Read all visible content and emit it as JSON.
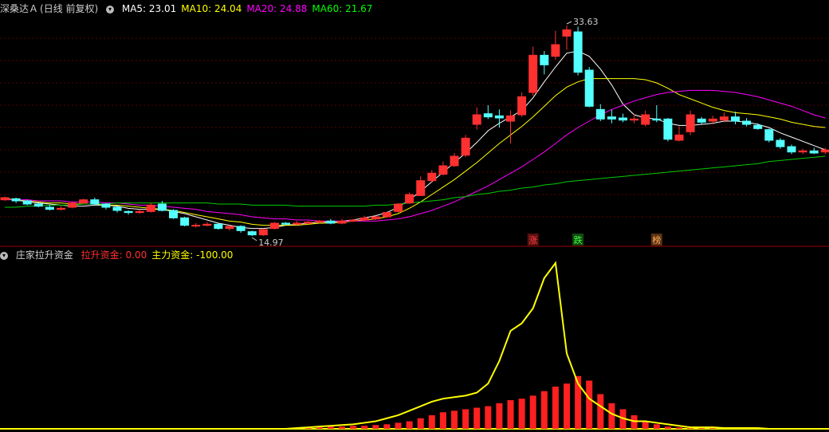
{
  "main_panel": {
    "stock_name": "深桑达Ａ",
    "period": "(日线 前复权)",
    "ma": [
      {
        "label": "MA5:",
        "value": "23.01",
        "color": "#ffffff"
      },
      {
        "label": "MA10:",
        "value": "24.04",
        "color": "#ffff00"
      },
      {
        "label": "MA20:",
        "value": "24.88",
        "color": "#ff00ff"
      },
      {
        "label": "MA60:",
        "value": "21.67",
        "color": "#00ff00"
      }
    ],
    "high_label": "33.63",
    "low_label": "14.97",
    "badges": [
      {
        "text": "涨",
        "color": "#ff4040",
        "bg": "#5a1010"
      },
      {
        "text": "跌",
        "color": "#40ff40",
        "bg": "#104a10"
      },
      {
        "text": "榜",
        "color": "#ffb060",
        "bg": "#5a3010"
      }
    ]
  },
  "sub_panel": {
    "indicator_name": "庄家拉升资金",
    "items": [
      {
        "label": "拉升资金:",
        "value": "0.00",
        "color": "#ff3030"
      },
      {
        "label": "主力资金:",
        "value": "-100.00",
        "color": "#ffff00"
      }
    ]
  },
  "chart_data": {
    "type": "candlestick",
    "price_range": [
      13.5,
      34.5
    ],
    "candles": [
      [
        17.2,
        17.4,
        17.5,
        17.1
      ],
      [
        17.3,
        17.1,
        17.4,
        16.9
      ],
      [
        17.1,
        16.8,
        17.2,
        16.7
      ],
      [
        16.8,
        16.6,
        16.9,
        16.5
      ],
      [
        16.5,
        16.3,
        16.7,
        16.2
      ],
      [
        16.3,
        16.4,
        16.6,
        16.2
      ],
      [
        16.5,
        16.9,
        17.0,
        16.4
      ],
      [
        16.9,
        17.2,
        17.3,
        16.8
      ],
      [
        17.2,
        16.8,
        17.4,
        16.7
      ],
      [
        16.8,
        16.5,
        16.9,
        16.3
      ],
      [
        16.5,
        16.2,
        16.6,
        16.0
      ],
      [
        16.1,
        16.0,
        16.2,
        15.8
      ],
      [
        16.0,
        16.1,
        16.3,
        15.9
      ],
      [
        16.1,
        16.7,
        16.9,
        16.0
      ],
      [
        16.8,
        16.2,
        17.1,
        16.1
      ],
      [
        16.2,
        15.5,
        16.3,
        15.4
      ],
      [
        15.5,
        14.8,
        15.6,
        14.7
      ],
      [
        14.8,
        14.8,
        15.0,
        14.6
      ],
      [
        14.8,
        14.9,
        15.1,
        14.7
      ],
      [
        14.9,
        14.5,
        15.0,
        14.4
      ],
      [
        14.5,
        14.7,
        14.8,
        14.3
      ],
      [
        14.7,
        14.3,
        14.8,
        14.1
      ],
      [
        14.2,
        13.9,
        14.3,
        13.8
      ],
      [
        13.9,
        14.4,
        14.5,
        13.8
      ],
      [
        14.5,
        15.0,
        15.1,
        14.4
      ],
      [
        15.0,
        14.9,
        15.1,
        14.8
      ],
      [
        14.9,
        15.0,
        15.2,
        14.8
      ],
      [
        15.0,
        15.1,
        15.2,
        14.9
      ],
      [
        15.1,
        15.2,
        15.3,
        15.0
      ],
      [
        15.2,
        15.0,
        15.4,
        14.9
      ],
      [
        15.0,
        15.2,
        15.4,
        14.9
      ],
      [
        15.2,
        15.3,
        15.4,
        15.1
      ],
      [
        15.3,
        15.5,
        15.7,
        15.2
      ],
      [
        15.4,
        15.6,
        15.7,
        15.3
      ],
      [
        15.6,
        16.0,
        16.1,
        15.5
      ],
      [
        16.1,
        16.8,
        16.9,
        16.0
      ],
      [
        16.9,
        17.7,
        17.9,
        16.8
      ],
      [
        17.6,
        19.0,
        19.4,
        17.6
      ],
      [
        19.0,
        19.7,
        20.0,
        18.8
      ],
      [
        19.6,
        20.4,
        20.8,
        19.5
      ],
      [
        20.4,
        21.3,
        21.6,
        20.3
      ],
      [
        21.4,
        23.0,
        23.3,
        21.2
      ],
      [
        24.3,
        25.2,
        25.9,
        23.8
      ],
      [
        25.3,
        25.0,
        26.1,
        24.8
      ],
      [
        25.1,
        24.9,
        25.7,
        24.0
      ],
      [
        24.6,
        25.1,
        25.6,
        22.5
      ],
      [
        25.2,
        26.9,
        27.3,
        25.0
      ],
      [
        27.3,
        30.8,
        31.6,
        27.0
      ],
      [
        30.8,
        29.9,
        31.2,
        29.0
      ],
      [
        30.7,
        31.8,
        33.1,
        30.4
      ],
      [
        32.6,
        33.2,
        33.6,
        31.3
      ],
      [
        33.0,
        29.2,
        33.5,
        28.9
      ],
      [
        29.4,
        26.0,
        29.7,
        25.9
      ],
      [
        25.7,
        24.8,
        26.2,
        24.6
      ],
      [
        25.0,
        24.8,
        25.7,
        24.4
      ],
      [
        24.9,
        24.7,
        25.3,
        24.5
      ],
      [
        24.7,
        24.8,
        25.3,
        24.4
      ],
      [
        24.3,
        25.2,
        25.6,
        24.1
      ],
      [
        24.8,
        24.7,
        26.1,
        24.5
      ],
      [
        24.8,
        22.9,
        24.9,
        22.7
      ],
      [
        22.8,
        23.3,
        24.1,
        22.7
      ],
      [
        23.6,
        25.2,
        25.6,
        23.3
      ],
      [
        24.8,
        24.5,
        25.0,
        24.3
      ],
      [
        24.6,
        24.8,
        25.1,
        24.3
      ],
      [
        24.7,
        25.0,
        25.4,
        24.5
      ],
      [
        25.0,
        24.6,
        25.5,
        24.3
      ],
      [
        24.6,
        24.3,
        24.9,
        24.1
      ],
      [
        24.2,
        23.9,
        24.4,
        23.8
      ],
      [
        23.8,
        22.8,
        23.9,
        22.6
      ],
      [
        22.8,
        22.2,
        23.0,
        22.0
      ],
      [
        22.2,
        21.7,
        22.4,
        21.5
      ],
      [
        21.7,
        21.8,
        22.0,
        21.5
      ],
      [
        21.8,
        21.6,
        22.1,
        21.5
      ],
      [
        21.7,
        21.9,
        22.1,
        21.5
      ]
    ],
    "series": [
      {
        "name": "MA5",
        "color": "#ffffff",
        "values": [
          17.3,
          17.2,
          17.0,
          16.9,
          16.8,
          16.7,
          16.6,
          16.6,
          16.7,
          16.7,
          16.6,
          16.4,
          16.3,
          16.3,
          16.3,
          16.1,
          15.9,
          15.6,
          15.3,
          15.0,
          14.8,
          14.6,
          14.5,
          14.5,
          14.6,
          14.8,
          14.9,
          15.0,
          15.1,
          15.1,
          15.2,
          15.3,
          15.5,
          15.7,
          16.0,
          16.5,
          17.2,
          18.0,
          18.9,
          19.8,
          20.7,
          21.6,
          22.6,
          23.7,
          24.4,
          25.0,
          25.6,
          26.8,
          28.3,
          29.7,
          31.0,
          31.2,
          30.7,
          29.5,
          28.0,
          26.2,
          25.2,
          24.9,
          24.8,
          24.4,
          24.2,
          24.2,
          24.3,
          24.4,
          24.6,
          24.6,
          24.5,
          24.3,
          24.0,
          23.5,
          23.1,
          22.7,
          22.3,
          21.9
        ]
      },
      {
        "name": "MA10",
        "color": "#ffff00",
        "values": [
          17.3,
          17.2,
          17.1,
          17.0,
          16.9,
          16.9,
          16.8,
          16.8,
          16.8,
          16.7,
          16.7,
          16.6,
          16.5,
          16.4,
          16.3,
          16.2,
          16.0,
          15.8,
          15.6,
          15.4,
          15.2,
          15.1,
          14.9,
          14.8,
          14.8,
          14.8,
          14.8,
          14.9,
          15.0,
          15.0,
          15.1,
          15.2,
          15.3,
          15.4,
          15.6,
          15.9,
          16.4,
          17.0,
          17.7,
          18.4,
          19.1,
          19.9,
          20.7,
          21.6,
          22.5,
          23.3,
          24.1,
          25.0,
          26.0,
          27.0,
          27.8,
          28.3,
          28.6,
          28.6,
          28.6,
          28.6,
          28.6,
          28.5,
          28.2,
          27.7,
          27.1,
          26.7,
          26.3,
          25.9,
          25.6,
          25.4,
          25.3,
          25.2,
          25.0,
          24.8,
          24.5,
          24.3,
          24.1,
          24.0
        ]
      },
      {
        "name": "MA20",
        "color": "#ff00ff",
        "values": [
          17.2,
          17.2,
          17.2,
          17.1,
          17.1,
          17.1,
          17.0,
          17.0,
          17.0,
          16.9,
          16.9,
          16.8,
          16.7,
          16.7,
          16.6,
          16.5,
          16.4,
          16.3,
          16.1,
          16.0,
          15.9,
          15.8,
          15.6,
          15.5,
          15.4,
          15.4,
          15.3,
          15.3,
          15.2,
          15.2,
          15.2,
          15.2,
          15.2,
          15.2,
          15.3,
          15.4,
          15.6,
          15.9,
          16.2,
          16.6,
          17.0,
          17.5,
          18.0,
          18.5,
          19.1,
          19.7,
          20.3,
          21.0,
          21.7,
          22.5,
          23.3,
          24.0,
          24.6,
          25.2,
          25.7,
          26.1,
          26.5,
          26.8,
          27.1,
          27.3,
          27.4,
          27.5,
          27.5,
          27.5,
          27.4,
          27.3,
          27.1,
          26.9,
          26.6,
          26.3,
          26.0,
          25.6,
          25.2,
          24.9
        ]
      },
      {
        "name": "MA60",
        "color": "#00cc00",
        "values": [
          16.5,
          16.5,
          16.6,
          16.6,
          16.7,
          16.7,
          16.7,
          16.8,
          16.8,
          16.8,
          16.9,
          16.9,
          16.9,
          16.9,
          16.9,
          16.9,
          16.9,
          16.9,
          16.9,
          16.8,
          16.8,
          16.8,
          16.7,
          16.7,
          16.7,
          16.7,
          16.6,
          16.6,
          16.6,
          16.6,
          16.6,
          16.6,
          16.6,
          16.7,
          16.7,
          16.8,
          16.9,
          17.0,
          17.1,
          17.2,
          17.4,
          17.5,
          17.7,
          17.8,
          18.0,
          18.1,
          18.3,
          18.4,
          18.6,
          18.7,
          18.9,
          19.0,
          19.1,
          19.2,
          19.3,
          19.4,
          19.5,
          19.6,
          19.7,
          19.8,
          19.9,
          20.0,
          20.1,
          20.2,
          20.3,
          20.4,
          20.5,
          20.6,
          20.8,
          20.9,
          21.0,
          21.1,
          21.2,
          21.3
        ]
      }
    ],
    "sub": {
      "bars": [
        0,
        0,
        0,
        0,
        0,
        0,
        0,
        0,
        0,
        0,
        0,
        0,
        0,
        0,
        0,
        0,
        0,
        0,
        0,
        0,
        0,
        0,
        0,
        0,
        0,
        0,
        1,
        2,
        2,
        3,
        3,
        4,
        4,
        5,
        6,
        8,
        10,
        14,
        18,
        22,
        24,
        26,
        28,
        30,
        34,
        38,
        40,
        44,
        50,
        56,
        60,
        70,
        64,
        46,
        34,
        26,
        18,
        10,
        6,
        3,
        2,
        1,
        1,
        1,
        0,
        0,
        0,
        0,
        0,
        0,
        0,
        0,
        0,
        0
      ],
      "line": [
        0,
        0,
        0,
        0,
        0,
        0,
        0,
        0,
        0,
        0,
        0,
        0,
        0,
        0,
        0,
        0,
        0,
        0,
        0,
        0,
        0,
        0,
        0,
        0,
        0,
        0,
        1,
        2,
        3,
        4,
        5,
        6,
        8,
        10,
        14,
        18,
        24,
        30,
        36,
        40,
        42,
        44,
        48,
        60,
        90,
        130,
        140,
        160,
        200,
        220,
        100,
        60,
        40,
        30,
        20,
        14,
        10,
        10,
        8,
        6,
        4,
        2,
        2,
        2,
        1,
        1,
        1,
        1,
        0,
        0,
        0,
        0,
        0,
        0
      ]
    }
  }
}
